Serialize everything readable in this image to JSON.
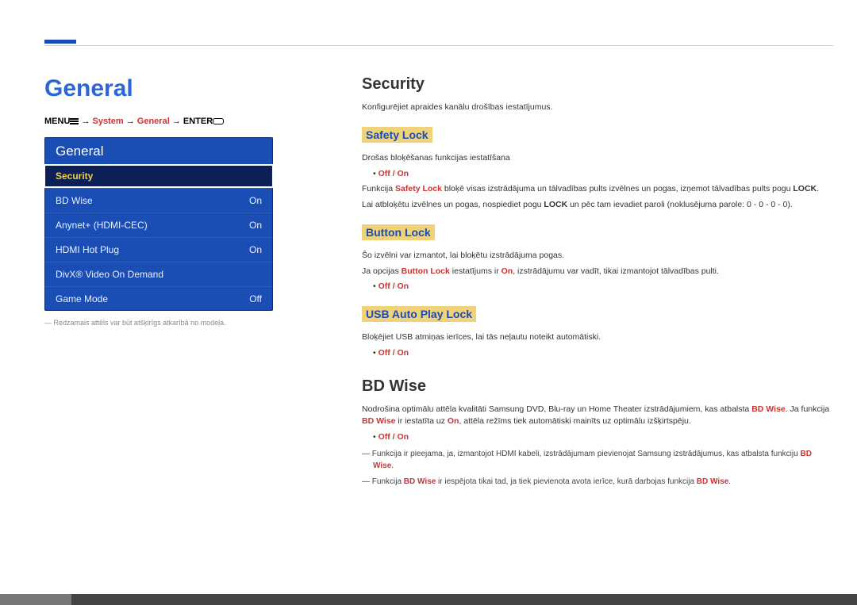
{
  "left": {
    "heading": "General",
    "breadcrumb": {
      "p1": "MENU",
      "arrow1": " → ",
      "system": "System",
      "arrow2": " → ",
      "general": "General",
      "arrow3": " → ",
      "p4": "ENTER"
    },
    "panel_title": "General",
    "items": [
      {
        "label": "Security",
        "value": ""
      },
      {
        "label": "BD Wise",
        "value": "On"
      },
      {
        "label": "Anynet+ (HDMI-CEC)",
        "value": "On"
      },
      {
        "label": "HDMI Hot Plug",
        "value": "On"
      },
      {
        "label": "DivX® Video On Demand",
        "value": ""
      },
      {
        "label": "Game Mode",
        "value": "Off"
      }
    ],
    "panel_note": "Redzamais attēls var būt atšķirīgs atkarībā no modeļa."
  },
  "right": {
    "security": {
      "heading": "Security",
      "intro": "Konfigurējiet apraides kanālu drošības iestatījumus.",
      "safety_lock": {
        "title": "Safety Lock",
        "p1": "Drošas bloķēšanas funkcijas iestatīšana",
        "off_on": "Off / On",
        "p2a": "Funkcija ",
        "p2b": "Safety Lock",
        "p2c": " bloķē visas izstrādājuma un tālvadības pults izvēlnes un pogas, izņemot tālvadības pults pogu ",
        "p2d": "LOCK",
        "p2e": ".",
        "p3a": "Lai atbloķētu izvēlnes un pogas, nospiediet pogu ",
        "p3b": "LOCK",
        "p3c": " un pēc tam ievadiet paroli (noklusējuma parole: 0 - 0 - 0 - 0)."
      },
      "button_lock": {
        "title": "Button Lock",
        "p1": "Šo izvēlni var izmantot, lai bloķētu izstrādājuma pogas.",
        "p2a": "Ja opcijas ",
        "p2b": "Button Lock",
        "p2c": " iestatījums ir ",
        "p2d": "On",
        "p2e": ", izstrādājumu var vadīt, tikai izmantojot tālvadības pulti.",
        "off_on": "Off / On"
      },
      "usb_lock": {
        "title": "USB Auto Play Lock",
        "p1": "Bloķējiet USB atmiņas ierīces, lai tās neļautu noteikt automātiski.",
        "off_on": "Off / On"
      }
    },
    "bdwise": {
      "heading": "BD Wise",
      "p1a": "Nodrošina optimālu attēla kvalitāti Samsung DVD, Blu-ray un Home Theater izstrādājumiem, kas atbalsta ",
      "p1b": "BD Wise",
      "p1c": ". Ja funkcija ",
      "p1d": "BD Wise",
      "p1e": " ir iestatīta uz ",
      "p1f": "On",
      "p1g": ", attēla režīms tiek automātiski mainīts uz optimālu izšķirtspēju.",
      "off_on": "Off / On",
      "note1a": "Funkcija ir pieejama, ja, izmantojot HDMI kabeli, izstrādājumam pievienojat Samsung izstrādājumus, kas atbalsta funkciju ",
      "note1b": "BD Wise",
      "note1c": ".",
      "note2a": "Funkcija ",
      "note2b": "BD Wise",
      "note2c": " ir iespējota tikai tad, ja tiek pievienota avota ierīce, kurā darbojas funkcija ",
      "note2d": "BD Wise",
      "note2e": "."
    }
  }
}
